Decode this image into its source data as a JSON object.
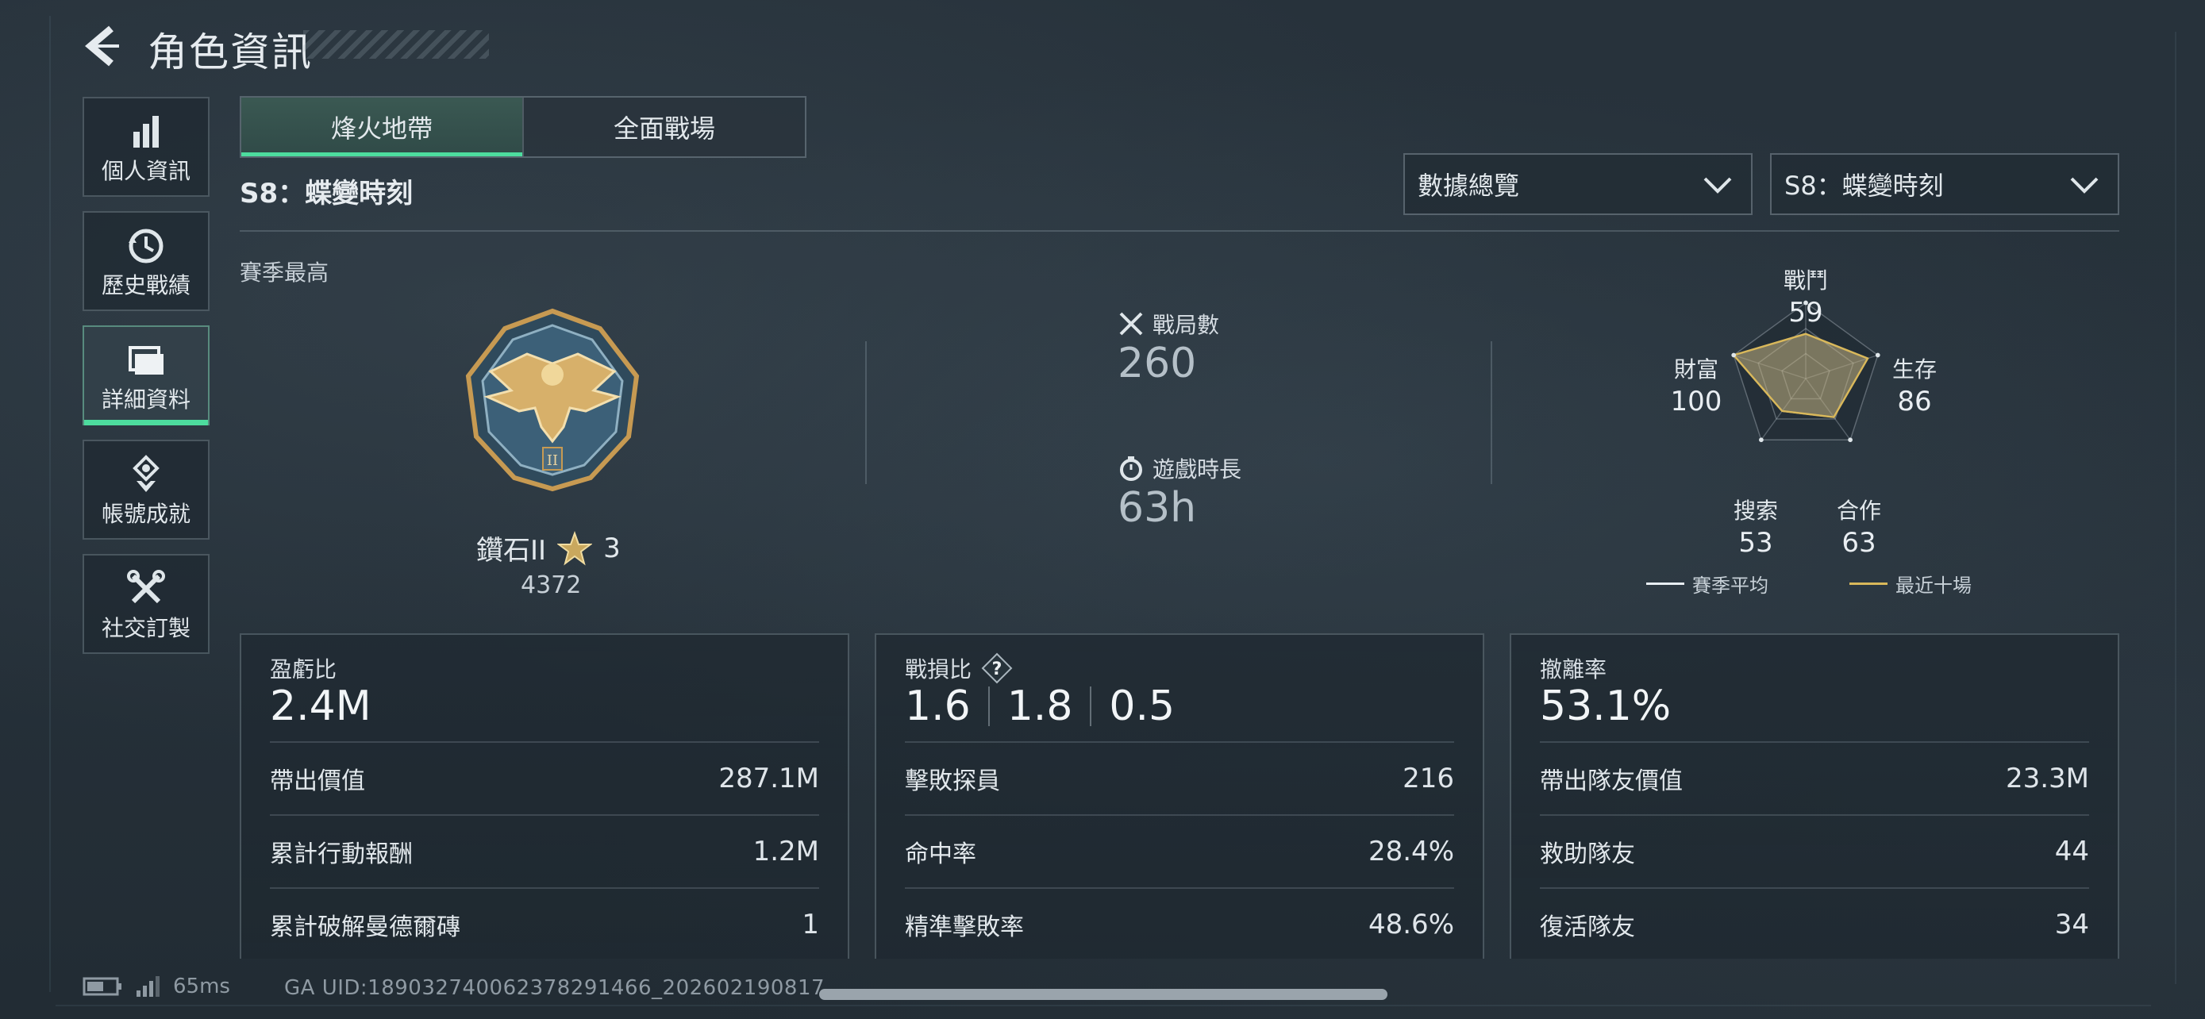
{
  "header": {
    "title": "角色資訊"
  },
  "sidebar": {
    "items": [
      {
        "label": "個人資訊",
        "icon": "bar-chart-icon",
        "active": false
      },
      {
        "label": "歷史戰績",
        "icon": "history-icon",
        "active": false
      },
      {
        "label": "詳細資料",
        "icon": "folder-icon",
        "active": true
      },
      {
        "label": "帳號成就",
        "icon": "medal-icon",
        "active": false
      },
      {
        "label": "社交訂製",
        "icon": "tools-icon",
        "active": false
      }
    ]
  },
  "tabs": [
    {
      "label": "烽火地帶",
      "active": true
    },
    {
      "label": "全面戰場",
      "active": false
    }
  ],
  "season_label": "S8：蝶變時刻",
  "filters": {
    "view": "數據總覽",
    "season": "S8：蝶變時刻"
  },
  "summary": {
    "season_best_label": "賽季最高",
    "rank_name": "鑽石II",
    "rank_stars": "3",
    "rank_score": "4372",
    "matches_label": "戰局數",
    "matches_value": "260",
    "playtime_label": "遊戲時長",
    "playtime_value": "63h"
  },
  "radar": {
    "axes": [
      {
        "label": "戰鬥",
        "value": "59"
      },
      {
        "label": "生存",
        "value": "86"
      },
      {
        "label": "合作",
        "value": "63"
      },
      {
        "label": "搜索",
        "value": "53"
      },
      {
        "label": "財富",
        "value": "100"
      }
    ],
    "legend_season_avg": "賽季平均",
    "legend_recent": "最近十場",
    "colors": {
      "season_avg": "#e8eef2",
      "recent": "#d9b85a"
    }
  },
  "panels": {
    "profit": {
      "title": "盈虧比",
      "big": "2.4M",
      "rows": [
        {
          "label": "帶出價值",
          "value": "287.1M"
        },
        {
          "label": "累計行動報酬",
          "value": "1.2M"
        },
        {
          "label": "累計破解曼德爾磚",
          "value": "1"
        }
      ]
    },
    "kd": {
      "title": "戰損比",
      "help": "?",
      "values": [
        "1.6",
        "1.8",
        "0.5"
      ],
      "rows": [
        {
          "label": "擊敗探員",
          "value": "216"
        },
        {
          "label": "命中率",
          "value": "28.4%"
        },
        {
          "label": "精準擊敗率",
          "value": "48.6%"
        }
      ]
    },
    "extract": {
      "title": "撤離率",
      "big": "53.1%",
      "rows": [
        {
          "label": "帶出隊友價值",
          "value": "23.3M"
        },
        {
          "label": "救助隊友",
          "value": "44"
        },
        {
          "label": "復活隊友",
          "value": "34"
        }
      ]
    }
  },
  "footer": {
    "ping": "65ms",
    "uid": "GA UID:18903274006237829​1466_202602190817"
  },
  "accent_color": "#4ddc9e"
}
